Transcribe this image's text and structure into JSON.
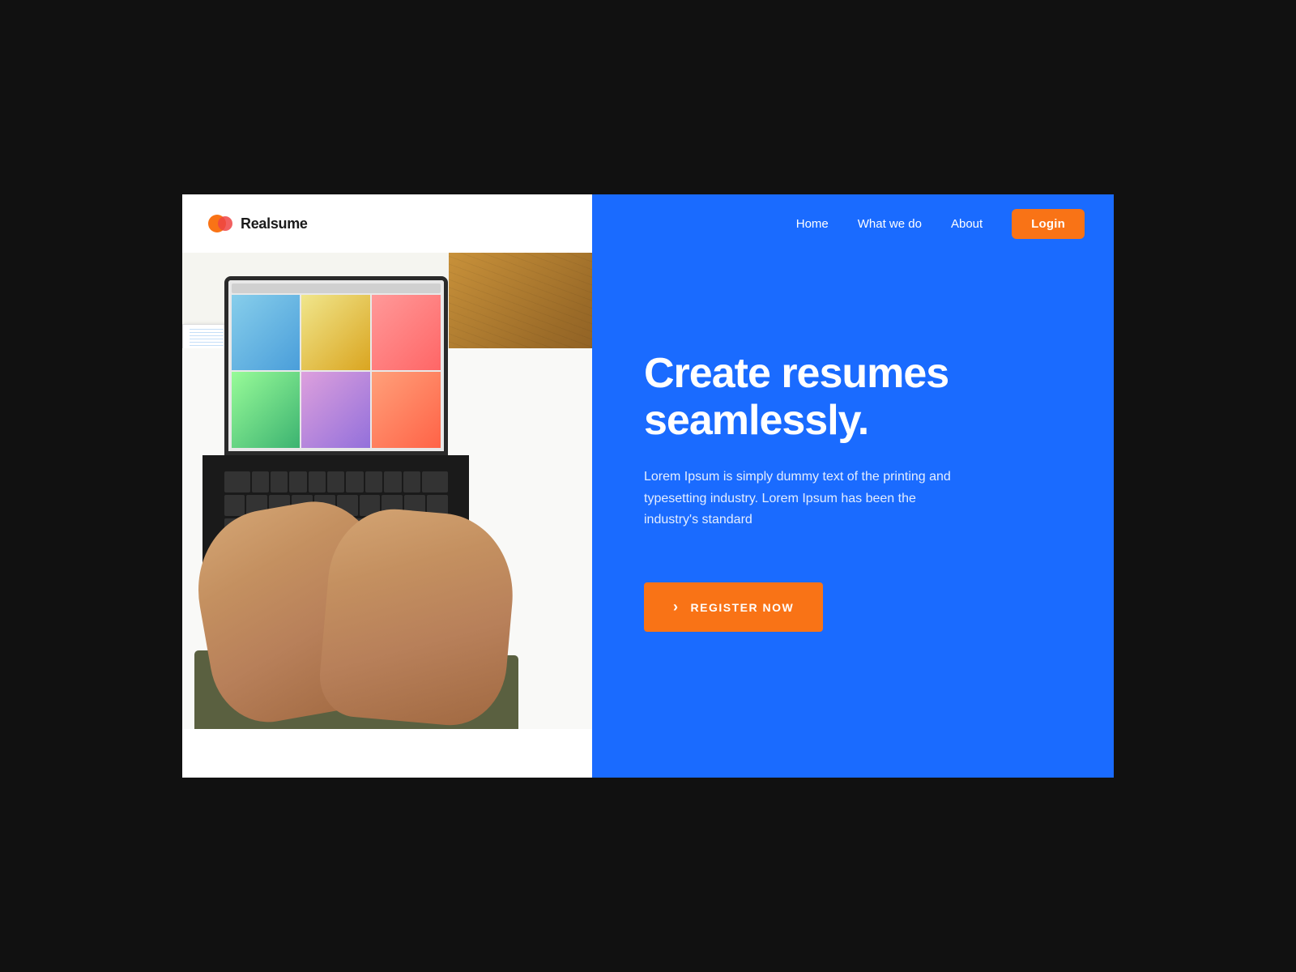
{
  "logo": {
    "text": "Realsume"
  },
  "nav": {
    "home": "Home",
    "what_we_do": "What we do",
    "about": "About",
    "login": "Login"
  },
  "hero": {
    "title_line1": "Create resumes",
    "title_line2": "seamlessly.",
    "description": "Lorem Ipsum is simply dummy text of the printing and typesetting industry. Lorem Ipsum has been the industry's standard",
    "register_button": "REGISTER NOW"
  },
  "colors": {
    "blue": "#1a6bff",
    "orange": "#f97316",
    "white": "#ffffff"
  }
}
